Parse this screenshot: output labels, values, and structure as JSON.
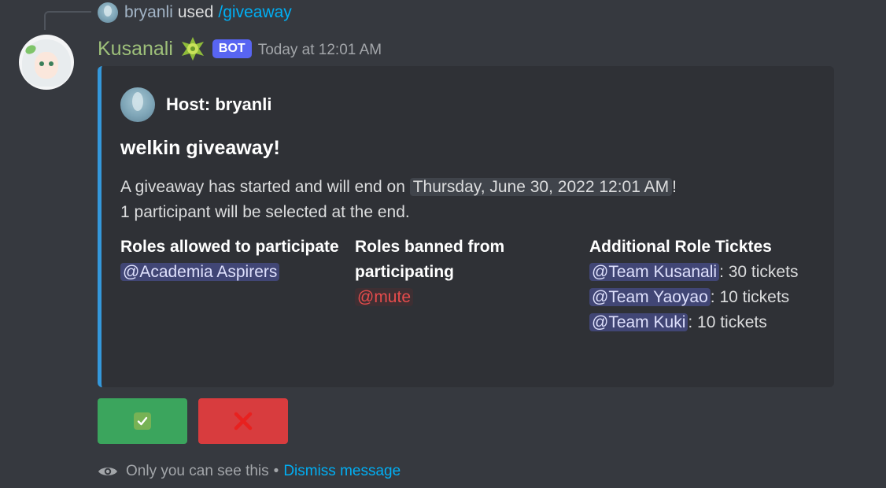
{
  "reply": {
    "username": "bryanli",
    "used_text": "used",
    "command": "/giveaway"
  },
  "message": {
    "author": "Kusanali",
    "badge": "BOT",
    "timestamp": "Today at 12:01 AM"
  },
  "embed": {
    "accent_color": "#3498db",
    "author_text": "Host: bryanli",
    "title": "welkin giveaway!",
    "desc_prefix": "A giveaway has started and will end on ",
    "desc_date": "Thursday, June 30, 2022 12:01 AM",
    "desc_suffix": "!",
    "desc_line2": "1 participant will be selected at the end.",
    "fields": [
      {
        "name": "Roles allowed to participate",
        "value_mention": "@Academia Aspirers"
      },
      {
        "name": "Roles banned from participating",
        "value_mention": "@mute"
      },
      {
        "name": "Additional Role Ticktes",
        "lines": [
          {
            "mention": "@Team Kusanali",
            "text": ": 30 tickets"
          },
          {
            "mention": "@Team Yaoyao",
            "text": ": 10 tickets"
          },
          {
            "mention": "@Team Kuki",
            "text": ": 10 tickets"
          }
        ]
      }
    ]
  },
  "buttons": {
    "accept": {
      "icon": "check-mark-icon",
      "symbol": "✓",
      "color": "#3ba55d"
    },
    "cancel": {
      "icon": "cross-mark-icon",
      "symbol": "✕",
      "color": "#d83c3e"
    }
  },
  "ephemeral": {
    "text": "Only you can see this",
    "separator": "•",
    "dismiss": "Dismiss message"
  }
}
